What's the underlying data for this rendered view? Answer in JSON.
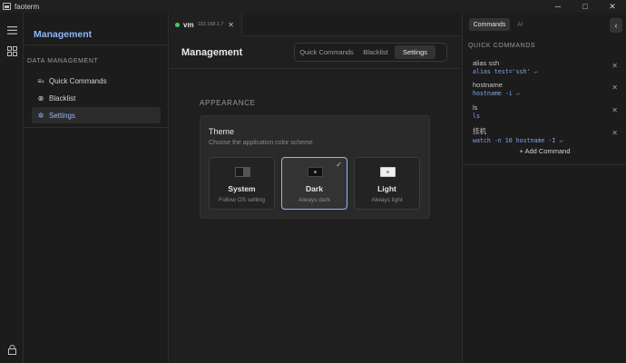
{
  "window": {
    "title": "faoterm",
    "controls": {
      "minimize": "─",
      "maximize": "□",
      "close": "✕"
    }
  },
  "rail": {
    "icons": [
      "list-icon",
      "grid-icon",
      "lock-icon"
    ]
  },
  "sidebar": {
    "title": "Management",
    "section": "DATA MANAGEMENT",
    "items": [
      {
        "label": "Quick Commands",
        "icon": "≡›"
      },
      {
        "label": "Blacklist",
        "icon": "⊗"
      },
      {
        "label": "Settings",
        "icon": "✲",
        "active": true
      }
    ]
  },
  "tabs": [
    {
      "name": "vm",
      "ip": "192.168.1.7",
      "close": "✕",
      "status_color": "#4cc36b"
    }
  ],
  "main": {
    "title": "Management",
    "segments": [
      "Quick Commands",
      "Blacklist",
      "Settings"
    ],
    "active_segment": "Settings",
    "section_label": "APPEARANCE",
    "theme": {
      "title": "Theme",
      "subtitle": "Choose the application color scheme",
      "options": [
        {
          "name": "System",
          "desc": "Follow OS setting"
        },
        {
          "name": "Dark",
          "desc": "Always dark",
          "selected": true,
          "check": "✓"
        },
        {
          "name": "Light",
          "desc": "Always light"
        }
      ]
    }
  },
  "right_panel": {
    "tabs": [
      "Commands",
      "AI"
    ],
    "active_tab": "Commands",
    "collapse": "‹",
    "heading": "QUICK COMMANDS",
    "commands": [
      {
        "name": "alias ssh",
        "value": "alias test='ssh'",
        "enter": "↵",
        "delete": "✕"
      },
      {
        "name": "hostname",
        "value": "hostname -i",
        "enter": "↵",
        "delete": "✕"
      },
      {
        "name": "ls",
        "value": "ls",
        "enter": "",
        "delete": "✕"
      },
      {
        "name": "挂机",
        "value": "watch -n 10 hostname -I",
        "enter": "↵",
        "delete": "✕"
      }
    ],
    "add_label": "+ Add Command"
  },
  "colors": {
    "accent": "#8fb6ff",
    "status_online": "#4cc36b",
    "background": "#1c1c1c"
  }
}
